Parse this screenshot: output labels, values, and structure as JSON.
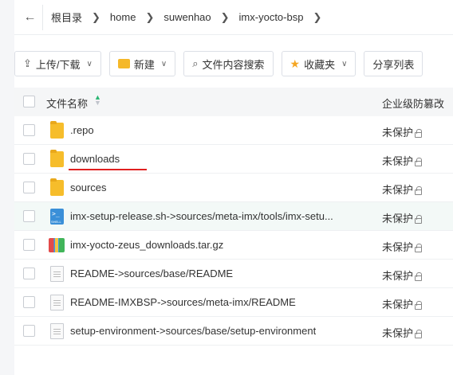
{
  "breadcrumb": {
    "back_icon": "arrow-left-icon",
    "items": [
      "根目录",
      "home",
      "suwenhao",
      "imx-yocto-bsp"
    ]
  },
  "toolbar": {
    "upload_label": "上传/下载",
    "new_label": "新建",
    "search_label": "文件内容搜索",
    "favorites_label": "收藏夹",
    "share_label": "分享列表"
  },
  "table": {
    "col_name": "文件名称",
    "col_perm": "企业级防篡改",
    "rows": [
      {
        "name": ".repo",
        "type": "folder",
        "perm": "未保护"
      },
      {
        "name": "downloads",
        "type": "folder",
        "perm": "未保护"
      },
      {
        "name": "sources",
        "type": "folder",
        "perm": "未保护"
      },
      {
        "name": "imx-setup-release.sh->sources/meta-imx/tools/imx-setu...",
        "type": "shell",
        "perm": "未保护"
      },
      {
        "name": "imx-yocto-zeus_downloads.tar.gz",
        "type": "archive",
        "perm": "未保护"
      },
      {
        "name": "README->sources/base/README",
        "type": "doc",
        "perm": "未保护"
      },
      {
        "name": "README-IMXBSP->sources/meta-imx/README",
        "type": "doc",
        "perm": "未保护"
      },
      {
        "name": "setup-environment->sources/base/setup-environment",
        "type": "doc",
        "perm": "未保护"
      }
    ]
  },
  "colors": {
    "folder": "#f6bd2b",
    "highlight_row": "#f3f9f7",
    "sort_active": "#2bb673",
    "annotation_underline": "#e02020"
  }
}
